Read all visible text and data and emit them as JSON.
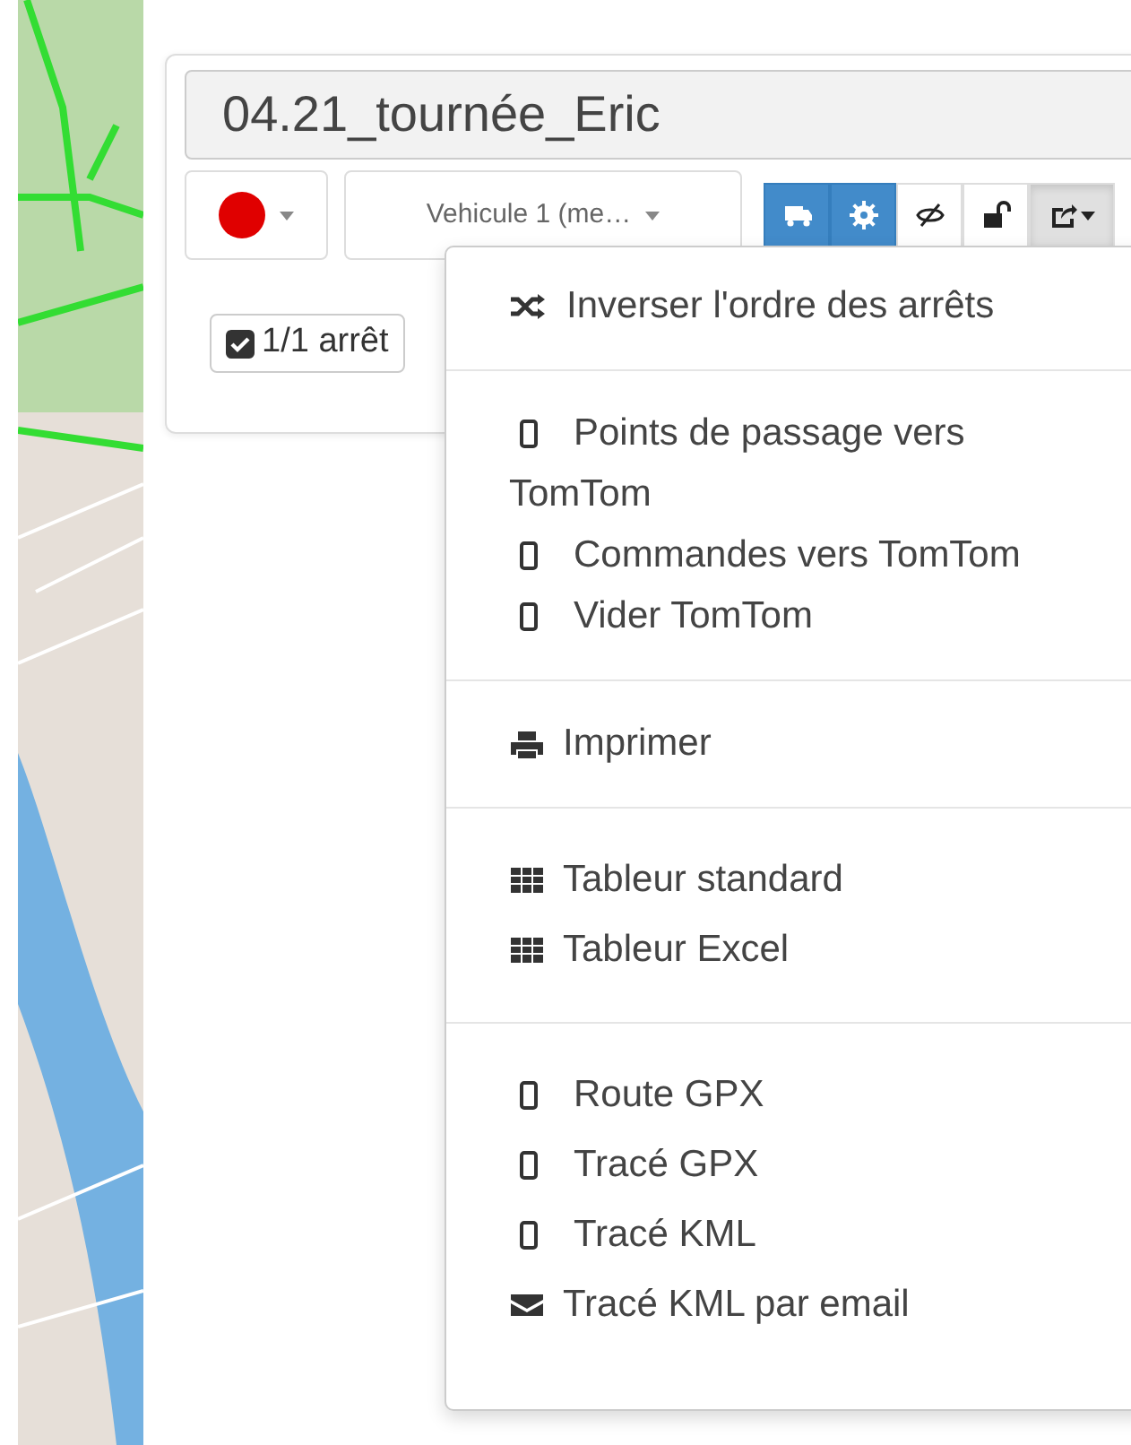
{
  "route_panel": {
    "title": "04.21_tournée_Eric",
    "color_picker": {
      "color": "#e00000"
    },
    "vehicle_select": {
      "value": "Vehicule 1 (me…"
    },
    "toolbar": [
      {
        "kind": "truck",
        "selected": true,
        "expanded": false
      },
      {
        "kind": "gear",
        "selected": true,
        "expanded": false
      },
      {
        "kind": "eye-slash",
        "selected": false,
        "expanded": false
      },
      {
        "kind": "unlock",
        "selected": false,
        "expanded": false
      },
      {
        "kind": "share",
        "selected": false,
        "expanded": true
      }
    ],
    "stops_toggle": {
      "label": "1/1 arrêt",
      "checked": true
    }
  },
  "export_menu": {
    "groups": [
      [
        {
          "kind": "shuffle",
          "label": "Inverser l'ordre des arrêts"
        }
      ],
      [
        {
          "kind": "mobile",
          "label": "Points de passage vers TomTom"
        },
        {
          "kind": "mobile",
          "label": "Commandes vers TomTom"
        },
        {
          "kind": "mobile",
          "label": "Vider TomTom"
        }
      ],
      [
        {
          "kind": "print",
          "label": "Imprimer"
        }
      ],
      [
        {
          "kind": "table",
          "label": "Tableur standard"
        },
        {
          "kind": "table",
          "label": "Tableur Excel"
        }
      ],
      [
        {
          "kind": "mobile",
          "label": "Route GPX"
        },
        {
          "kind": "mobile",
          "label": "Tracé GPX"
        },
        {
          "kind": "mobile",
          "label": "Tracé KML"
        },
        {
          "kind": "mail",
          "label": "Tracé KML par email"
        }
      ]
    ]
  }
}
